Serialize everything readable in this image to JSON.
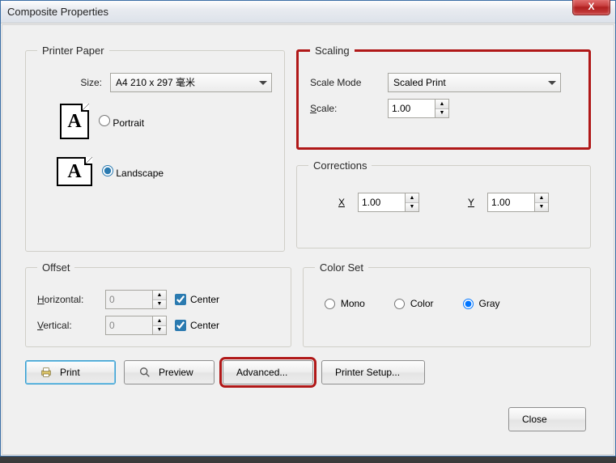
{
  "window": {
    "title": "Composite Properties",
    "close": "X"
  },
  "printer_paper": {
    "legend": "Printer Paper",
    "size_label": "Size:",
    "size_value": "A4 210 x 297 毫米",
    "portrait_label": "Portrait",
    "landscape_label": "Landscape",
    "portrait_checked": false,
    "landscape_checked": true
  },
  "scaling": {
    "legend": "Scaling",
    "mode_label": "Scale Mode",
    "mode_value": "Scaled Print",
    "scale_label": "Scale:",
    "scale_value": "1.00"
  },
  "corrections": {
    "legend": "Corrections",
    "x_label": "X",
    "x_value": "1.00",
    "y_label": "Y",
    "y_value": "1.00"
  },
  "offset": {
    "legend": "Offset",
    "horizontal_label": "Horizontal:",
    "horizontal_value": "0",
    "vertical_label": "Vertical:",
    "vertical_value": "0",
    "center_label": "Center",
    "h_center_checked": true,
    "v_center_checked": true
  },
  "colorset": {
    "legend": "Color Set",
    "mono": "Mono",
    "color": "Color",
    "gray": "Gray",
    "selected": "gray"
  },
  "buttons": {
    "print": "Print",
    "preview": "Preview",
    "advanced": "Advanced...",
    "printer_setup": "Printer Setup...",
    "close": "Close"
  }
}
